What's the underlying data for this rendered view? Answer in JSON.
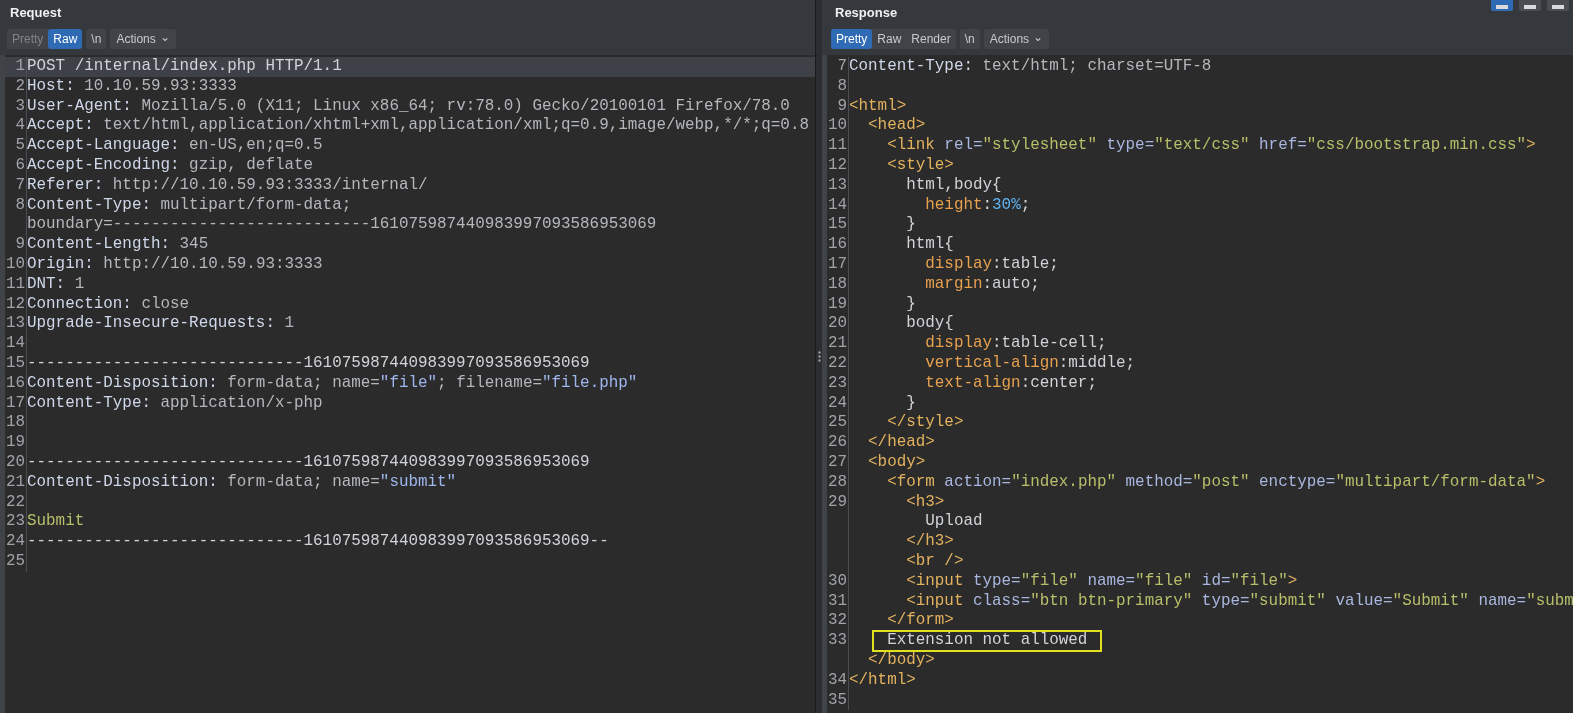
{
  "request": {
    "title": "Request",
    "tabs": [
      {
        "label": "Pretty",
        "selected": false,
        "disabled": true
      },
      {
        "label": "Raw",
        "selected": true,
        "disabled": false
      },
      {
        "label": "\\n",
        "selected": false,
        "disabled": false
      }
    ],
    "actions": {
      "label": "Actions",
      "caret": "⌄"
    },
    "lines": [
      {
        "n": "1",
        "selected": true,
        "segs": [
          {
            "kind": "plain",
            "t": "POST /internal/index.php HTTP/1.1"
          }
        ]
      },
      {
        "n": "2",
        "selected": false,
        "segs": [
          {
            "kind": "key",
            "t": "Host:"
          },
          {
            "kind": "val",
            "t": " 10.10.59.93:3333"
          }
        ]
      },
      {
        "n": "3",
        "selected": false,
        "segs": [
          {
            "kind": "key",
            "t": "User-Agent:"
          },
          {
            "kind": "val",
            "t": " Mozilla/5.0 (X11; Linux x86_64; rv:78.0) Gecko/20100101 Firefox/78.0"
          }
        ]
      },
      {
        "n": "4",
        "selected": false,
        "segs": [
          {
            "kind": "key",
            "t": "Accept:"
          },
          {
            "kind": "val",
            "t": " text/html,application/xhtml+xml,application/xml;q=0.9,image/webp,*/*;q=0.8"
          }
        ]
      },
      {
        "n": "5",
        "selected": false,
        "segs": [
          {
            "kind": "key",
            "t": "Accept-Language:"
          },
          {
            "kind": "val",
            "t": " en-US,en;q=0.5"
          }
        ]
      },
      {
        "n": "6",
        "selected": false,
        "segs": [
          {
            "kind": "key",
            "t": "Accept-Encoding:"
          },
          {
            "kind": "val",
            "t": " gzip, deflate"
          }
        ]
      },
      {
        "n": "7",
        "selected": false,
        "segs": [
          {
            "kind": "key",
            "t": "Referer:"
          },
          {
            "kind": "val",
            "t": " http://10.10.59.93:3333/internal/"
          }
        ]
      },
      {
        "n": "8",
        "selected": false,
        "segs": [
          {
            "kind": "key",
            "t": "Content-Type:"
          },
          {
            "kind": "val",
            "t": " multipart/form-data;"
          }
        ]
      },
      {
        "selected": false,
        "segs": [
          {
            "kind": "val",
            "t": "boundary=---------------------------161075987440983997093586953069"
          }
        ]
      },
      {
        "n": "9",
        "selected": false,
        "segs": [
          {
            "kind": "key",
            "t": "Content-Length:"
          },
          {
            "kind": "val",
            "t": " 345"
          }
        ]
      },
      {
        "n": "10",
        "selected": false,
        "segs": [
          {
            "kind": "key",
            "t": "Origin:"
          },
          {
            "kind": "val",
            "t": " http://10.10.59.93:3333"
          }
        ]
      },
      {
        "n": "11",
        "selected": false,
        "segs": [
          {
            "kind": "key",
            "t": "DNT:"
          },
          {
            "kind": "val",
            "t": " 1"
          }
        ]
      },
      {
        "n": "12",
        "selected": false,
        "segs": [
          {
            "kind": "key",
            "t": "Connection:"
          },
          {
            "kind": "val",
            "t": " close"
          }
        ]
      },
      {
        "n": "13",
        "selected": false,
        "segs": [
          {
            "kind": "key",
            "t": "Upgrade-Insecure-Requests:"
          },
          {
            "kind": "val",
            "t": " 1"
          }
        ]
      },
      {
        "n": "14",
        "selected": false
      },
      {
        "n": "15",
        "selected": false,
        "segs": [
          {
            "kind": "plain",
            "t": "-----------------------------161075987440983997093586953069"
          }
        ]
      },
      {
        "n": "16",
        "selected": false,
        "segs": [
          {
            "kind": "key",
            "t": "Content-Disposition:"
          },
          {
            "kind": "val",
            "t": " form-data; name="
          },
          {
            "kind": "qstr",
            "t": "\"file\""
          },
          {
            "kind": "val",
            "t": "; filename="
          },
          {
            "kind": "qstr",
            "t": "\"file.php\""
          }
        ]
      },
      {
        "n": "17",
        "selected": false,
        "segs": [
          {
            "kind": "key",
            "t": "Content-Type:"
          },
          {
            "kind": "val",
            "t": " application/x-php"
          }
        ]
      },
      {
        "n": "18",
        "selected": false
      },
      {
        "n": "19",
        "selected": false
      },
      {
        "n": "20",
        "selected": false,
        "segs": [
          {
            "kind": "plain",
            "t": "-----------------------------161075987440983997093586953069"
          }
        ]
      },
      {
        "n": "21",
        "selected": false,
        "segs": [
          {
            "kind": "key",
            "t": "Content-Disposition:"
          },
          {
            "kind": "val",
            "t": " form-data; name="
          },
          {
            "kind": "qstr",
            "t": "\"submit\""
          }
        ]
      },
      {
        "n": "22",
        "selected": false
      },
      {
        "n": "23",
        "selected": false,
        "segs": [
          {
            "kind": "body",
            "t": "Submit"
          }
        ]
      },
      {
        "n": "24",
        "selected": false,
        "segs": [
          {
            "kind": "plain",
            "t": "-----------------------------161075987440983997093586953069--"
          }
        ]
      },
      {
        "n": "25",
        "selected": false
      }
    ]
  },
  "response": {
    "title": "Response",
    "tabs": [
      {
        "label": "Pretty",
        "selected": true,
        "disabled": false
      },
      {
        "label": "Raw",
        "selected": false,
        "disabled": false
      },
      {
        "label": "Render",
        "selected": false,
        "disabled": false
      },
      {
        "label": "\\n",
        "selected": false,
        "disabled": false
      }
    ],
    "actions": {
      "label": "Actions",
      "caret": "⌄"
    },
    "lines": [
      {
        "n": "7",
        "segs": [
          {
            "kind": "key",
            "t": "Content-Type:"
          },
          {
            "kind": "val",
            "t": " text/html; charset=UTF-8"
          }
        ]
      },
      {
        "n": "8"
      },
      {
        "n": "9",
        "segs": [
          {
            "kind": "tag",
            "t": "<html>"
          }
        ]
      },
      {
        "n": "10",
        "segs": [
          {
            "kind": "tag",
            "t": "  <head>"
          }
        ]
      },
      {
        "n": "11",
        "segs": [
          {
            "kind": "tag",
            "t": "    <link"
          },
          {
            "kind": "attr",
            "t": " rel="
          },
          {
            "kind": "str",
            "t": "\"stylesheet\""
          },
          {
            "kind": "attr",
            "t": " type="
          },
          {
            "kind": "str",
            "t": "\"text/css\""
          },
          {
            "kind": "attr",
            "t": " href="
          },
          {
            "kind": "str",
            "t": "\"css/bootstrap.min.css\""
          },
          {
            "kind": "tag",
            "t": ">"
          }
        ]
      },
      {
        "n": "12",
        "segs": [
          {
            "kind": "tag",
            "t": "    <style>"
          }
        ]
      },
      {
        "n": "13",
        "segs": [
          {
            "kind": "plain",
            "t": "      html,body{"
          }
        ]
      },
      {
        "n": "14",
        "segs": [
          {
            "kind": "prop",
            "t": "        height"
          },
          {
            "kind": "plain",
            "t": ":"
          },
          {
            "kind": "num",
            "t": "30%"
          },
          {
            "kind": "plain",
            "t": ";"
          }
        ]
      },
      {
        "n": "15",
        "segs": [
          {
            "kind": "plain",
            "t": "      }"
          }
        ]
      },
      {
        "n": "16",
        "segs": [
          {
            "kind": "plain",
            "t": "      html{"
          }
        ]
      },
      {
        "n": "17",
        "segs": [
          {
            "kind": "prop",
            "t": "        display"
          },
          {
            "kind": "plain",
            "t": ":table;"
          }
        ]
      },
      {
        "n": "18",
        "segs": [
          {
            "kind": "prop",
            "t": "        margin"
          },
          {
            "kind": "plain",
            "t": ":auto;"
          }
        ]
      },
      {
        "n": "19",
        "segs": [
          {
            "kind": "plain",
            "t": "      }"
          }
        ]
      },
      {
        "n": "20",
        "segs": [
          {
            "kind": "plain",
            "t": "      body{"
          }
        ]
      },
      {
        "n": "21",
        "segs": [
          {
            "kind": "prop",
            "t": "        display"
          },
          {
            "kind": "plain",
            "t": ":table-cell;"
          }
        ]
      },
      {
        "n": "22",
        "segs": [
          {
            "kind": "prop",
            "t": "        vertical-align"
          },
          {
            "kind": "plain",
            "t": ":middle;"
          }
        ]
      },
      {
        "n": "23",
        "segs": [
          {
            "kind": "prop",
            "t": "        text-align"
          },
          {
            "kind": "plain",
            "t": ":center;"
          }
        ]
      },
      {
        "n": "24",
        "segs": [
          {
            "kind": "plain",
            "t": "      }"
          }
        ]
      },
      {
        "n": "25",
        "segs": [
          {
            "kind": "tag",
            "t": "    </style>"
          }
        ]
      },
      {
        "n": "26",
        "segs": [
          {
            "kind": "tag",
            "t": "  </head>"
          }
        ]
      },
      {
        "n": "27",
        "segs": [
          {
            "kind": "tag",
            "t": "  <body>"
          }
        ]
      },
      {
        "n": "28",
        "segs": [
          {
            "kind": "tag",
            "t": "    <form"
          },
          {
            "kind": "attr",
            "t": " action="
          },
          {
            "kind": "str",
            "t": "\"index.php\""
          },
          {
            "kind": "attr",
            "t": " method="
          },
          {
            "kind": "str",
            "t": "\"post\""
          },
          {
            "kind": "attr",
            "t": " enctype="
          },
          {
            "kind": "str",
            "t": "\"multipart/form-data\""
          },
          {
            "kind": "tag",
            "t": ">"
          }
        ]
      },
      {
        "n": "29",
        "segs": [
          {
            "kind": "tag",
            "t": "      <h3>"
          }
        ]
      },
      {
        "segs": [
          {
            "kind": "plain",
            "t": "        Upload"
          }
        ]
      },
      {
        "segs": [
          {
            "kind": "tag",
            "t": "      </h3>"
          }
        ]
      },
      {
        "segs": [
          {
            "kind": "tag",
            "t": "      <br />"
          }
        ]
      },
      {
        "n": "30",
        "segs": [
          {
            "kind": "tag",
            "t": "      <input"
          },
          {
            "kind": "attr",
            "t": " type="
          },
          {
            "kind": "str",
            "t": "\"file\""
          },
          {
            "kind": "attr",
            "t": " name="
          },
          {
            "kind": "str",
            "t": "\"file\""
          },
          {
            "kind": "attr",
            "t": " id="
          },
          {
            "kind": "str",
            "t": "\"file\""
          },
          {
            "kind": "tag",
            "t": ">"
          }
        ]
      },
      {
        "n": "31",
        "segs": [
          {
            "kind": "tag",
            "t": "      <input"
          },
          {
            "kind": "attr",
            "t": " class="
          },
          {
            "kind": "str",
            "t": "\"btn btn-primary\""
          },
          {
            "kind": "attr",
            "t": " type="
          },
          {
            "kind": "str",
            "t": "\"submit\""
          },
          {
            "kind": "attr",
            "t": " value="
          },
          {
            "kind": "str",
            "t": "\"Submit\""
          },
          {
            "kind": "attr",
            "t": " name="
          },
          {
            "kind": "str",
            "t": "\"subm"
          }
        ]
      },
      {
        "n": "32",
        "segs": [
          {
            "kind": "tag",
            "t": "    </form>"
          }
        ]
      },
      {
        "n": "33",
        "segs": [
          {
            "kind": "note",
            "t": "    Extension not allowed"
          }
        ]
      },
      {
        "segs": [
          {
            "kind": "tag",
            "t": "  </body>"
          }
        ]
      },
      {
        "n": "34",
        "segs": [
          {
            "kind": "tag",
            "t": "</html>"
          }
        ]
      },
      {
        "n": "35"
      }
    ]
  },
  "layout_buttons": [
    {
      "selected": true
    },
    {
      "selected": false
    },
    {
      "selected": false
    }
  ]
}
